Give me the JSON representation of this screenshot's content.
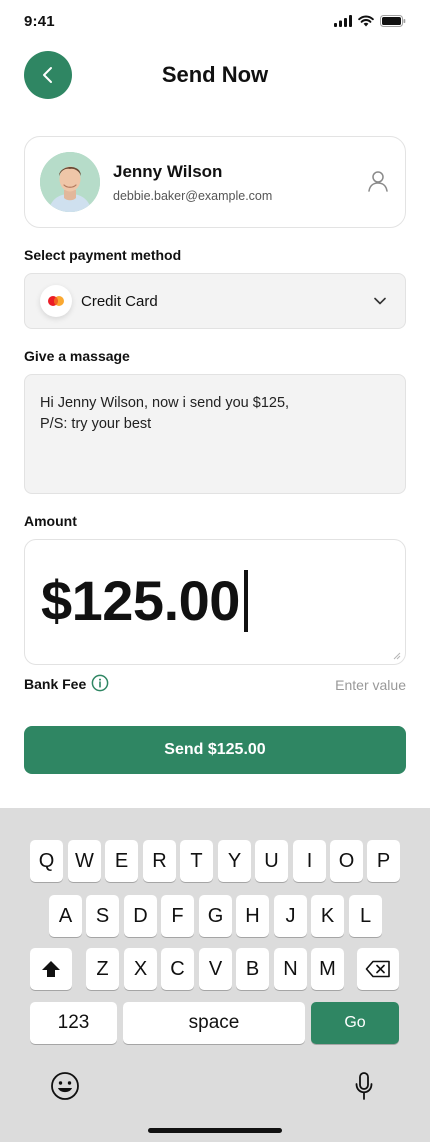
{
  "status_bar": {
    "time": "9:41"
  },
  "header": {
    "title": "Send Now"
  },
  "contact": {
    "name": "Jenny Wilson",
    "email": "debbie.baker@example.com"
  },
  "payment": {
    "label": "Select payment method",
    "selected": "Credit Card"
  },
  "message": {
    "label": "Give a massage",
    "line1": "Hi Jenny Wilson, now i send you $125,",
    "line2": "P/S: try your best"
  },
  "amount": {
    "label": "Amount",
    "value": "$125.00"
  },
  "bank_fee": {
    "label": "Bank Fee",
    "placeholder": "Enter value"
  },
  "send_button": {
    "label": "Send $125.00"
  },
  "keyboard": {
    "row1": [
      "Q",
      "W",
      "E",
      "R",
      "T",
      "Y",
      "U",
      "I",
      "O",
      "P"
    ],
    "row2": [
      "A",
      "S",
      "D",
      "F",
      "G",
      "H",
      "J",
      "K",
      "L"
    ],
    "row3": [
      "Z",
      "X",
      "C",
      "V",
      "B",
      "N",
      "M"
    ],
    "numbers_key": "123",
    "space_key": "space",
    "go_key": "Go"
  },
  "colors": {
    "accent": "#2f8663",
    "field_bg": "#f3f3f3",
    "keyboard_bg": "#dcdcdc"
  },
  "icons": [
    "back-arrow-icon",
    "user-icon",
    "mastercard-icon",
    "chevron-down-icon",
    "info-icon",
    "shift-icon",
    "backspace-icon",
    "emoji-icon",
    "microphone-icon"
  ]
}
